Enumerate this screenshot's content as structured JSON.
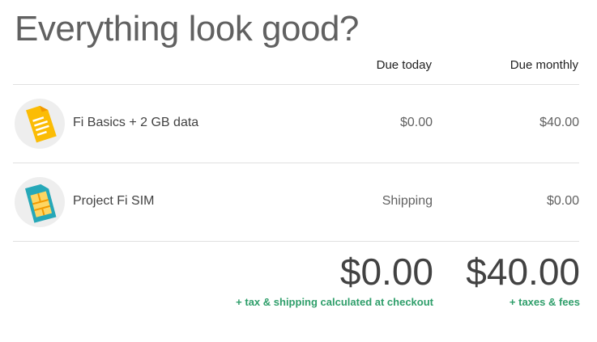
{
  "header": {
    "title": "Everything look good?",
    "col_today": "Due today",
    "col_monthly": "Due monthly"
  },
  "items": [
    {
      "icon": "document-icon",
      "label": "Fi Basics + 2 GB data",
      "due_today": "$0.00",
      "due_monthly": "$40.00"
    },
    {
      "icon": "sim-card-icon",
      "label": "Project Fi SIM",
      "due_today": "Shipping",
      "due_monthly": "$0.00"
    }
  ],
  "totals": {
    "today": "$0.00",
    "monthly": "$40.00",
    "today_note": "+ tax & shipping calculated at checkout",
    "monthly_note": "+ taxes & fees"
  },
  "colors": {
    "accent_green": "#2e9e6a",
    "doc_yellow": "#fbbc05",
    "sim_teal": "#26a8b8"
  }
}
